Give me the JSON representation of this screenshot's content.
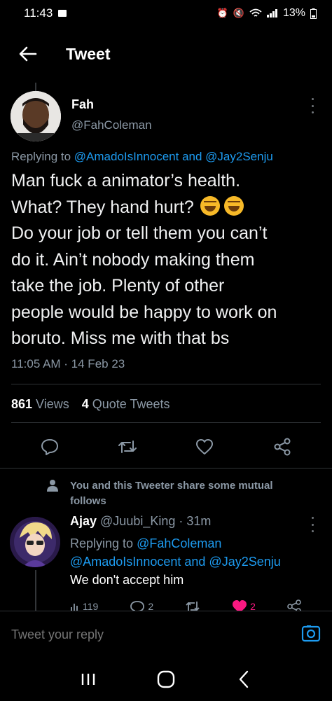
{
  "status_bar": {
    "time": "11:43",
    "battery": "13%"
  },
  "header": {
    "title": "Tweet"
  },
  "main_tweet": {
    "name": "Fah",
    "handle": "@FahColeman",
    "replying_prefix": "Replying to ",
    "replying_user1": "@AmadoIsInnocent",
    "replying_and": " and ",
    "replying_user2": "@Jay2Senju",
    "lines": [
      "Man fuck a animator’s health.",
      "What? They hand hurt? ",
      "Do your job or tell them you can’t",
      "do it. Ain’t nobody making them",
      "take the job. Plenty of other",
      "people would be happy to work on",
      "boruto. Miss me with that bs"
    ],
    "emoji": "rolling-on-floor-laughing-emoji",
    "timestamp": "11:05 AM · 14 Feb 23",
    "views_count": "861",
    "views_label": "Views",
    "quotes_count": "4",
    "quotes_label": "Quote Tweets"
  },
  "mutual": {
    "text": "You and this Tweeter share some mutual follows"
  },
  "reply_tweet": {
    "name": "Ajay",
    "meta": " @Juubi_King · 31m",
    "replying_prefix": "Replying to ",
    "replying_user1": "@FahColeman",
    "replying_user2": "@AmadoIsInnocent",
    "replying_and": " and ",
    "replying_user3": "@Jay2Senju",
    "text": "We don't accept him",
    "views": "119",
    "replies": "2",
    "likes": "2"
  },
  "composer": {
    "placeholder": "Tweet your reply"
  },
  "colors": {
    "accent": "#1d9bf0",
    "like": "#f91880",
    "muted": "#8b98a5"
  }
}
